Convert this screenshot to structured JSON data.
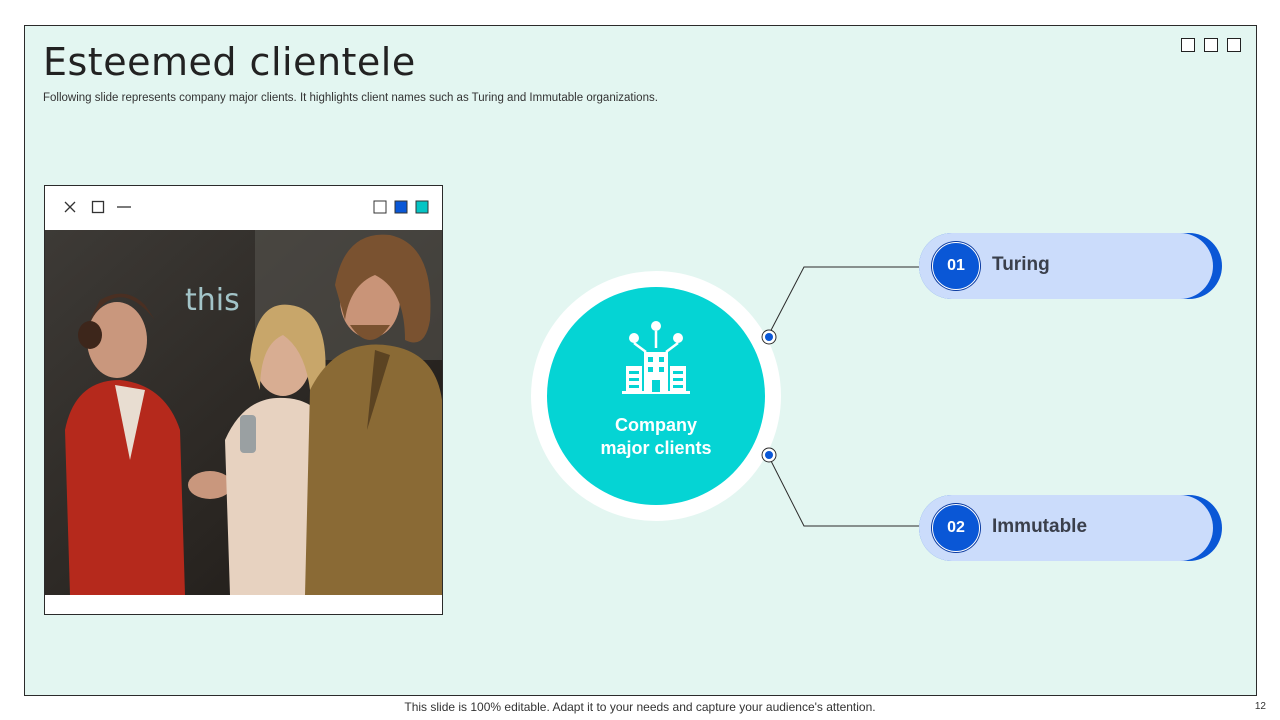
{
  "slide": {
    "title": "Esteemed clientele",
    "subtitle": "Following slide represents company major clients. It highlights client names such as Turing and Immutable organizations."
  },
  "center": {
    "label_line1": "Company",
    "label_line2": "major clients",
    "icon": "building-network-icon"
  },
  "clients": [
    {
      "number": "01",
      "name": "Turing"
    },
    {
      "number": "02",
      "name": "Immutable"
    }
  ],
  "window_controls": {
    "icons": [
      "close-icon",
      "maximize-icon",
      "minimize-icon"
    ],
    "swatches": [
      "#ffffff",
      "#0a57d6",
      "#05c4c4"
    ]
  },
  "colors": {
    "background": "#e3f6f1",
    "accent_teal": "#05d4d4",
    "accent_blue": "#0a57d6",
    "pill_light": "#cbdcfb"
  },
  "footer": {
    "note": "This slide is 100% editable. Adapt it to your needs and capture your audience's attention.",
    "page_number": "12"
  }
}
